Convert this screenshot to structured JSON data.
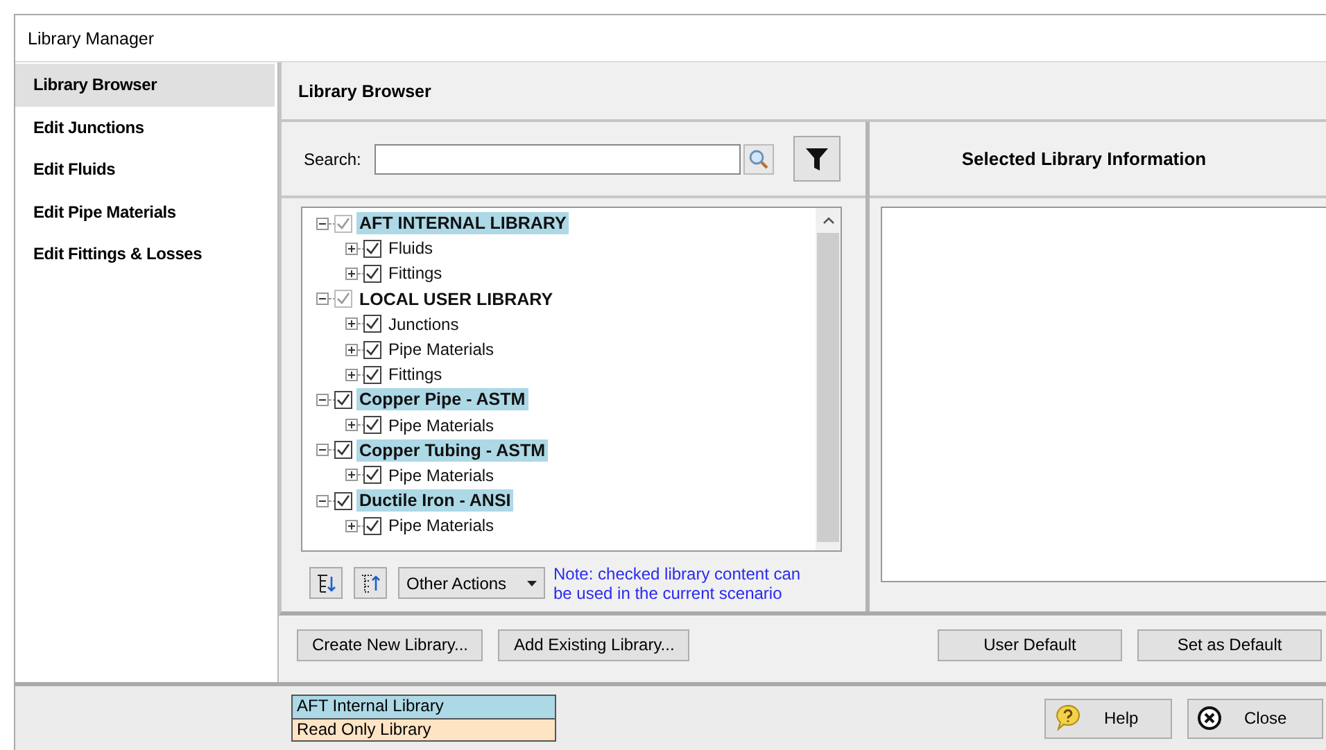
{
  "window": {
    "title": "Library Manager"
  },
  "sidebar": {
    "items": [
      {
        "label": "Library Browser",
        "selected": true
      },
      {
        "label": "Edit Junctions",
        "selected": false
      },
      {
        "label": "Edit Fluids",
        "selected": false
      },
      {
        "label": "Edit Pipe Materials",
        "selected": false
      },
      {
        "label": "Edit Fittings & Losses",
        "selected": false
      }
    ]
  },
  "panel_title": "Library Browser",
  "search": {
    "label": "Search:"
  },
  "tree": [
    {
      "label": "AFT INTERNAL LIBRARY",
      "checked": true,
      "disabled": true,
      "expanded": true,
      "highlight": true,
      "children": [
        {
          "label": "Fluids",
          "checked": true,
          "disabled": false,
          "expanded": false,
          "highlight": false
        },
        {
          "label": "Fittings",
          "checked": true,
          "disabled": false,
          "expanded": false,
          "highlight": false
        }
      ]
    },
    {
      "label": "LOCAL USER LIBRARY",
      "checked": true,
      "disabled": true,
      "expanded": true,
      "highlight": false,
      "children": [
        {
          "label": "Junctions",
          "checked": true,
          "disabled": false,
          "expanded": false,
          "highlight": false
        },
        {
          "label": "Pipe Materials",
          "checked": true,
          "disabled": false,
          "expanded": false,
          "highlight": false
        },
        {
          "label": "Fittings",
          "checked": true,
          "disabled": false,
          "expanded": false,
          "highlight": false
        }
      ]
    },
    {
      "label": "Copper Pipe - ASTM",
      "checked": true,
      "disabled": false,
      "expanded": true,
      "highlight": true,
      "children": [
        {
          "label": "Pipe Materials",
          "checked": true,
          "disabled": false,
          "expanded": false,
          "highlight": false
        }
      ]
    },
    {
      "label": "Copper Tubing - ASTM",
      "checked": true,
      "disabled": false,
      "expanded": true,
      "highlight": true,
      "children": [
        {
          "label": "Pipe Materials",
          "checked": true,
          "disabled": false,
          "expanded": false,
          "highlight": false
        }
      ]
    },
    {
      "label": "Ductile Iron - ANSI",
      "checked": true,
      "disabled": false,
      "expanded": true,
      "highlight": true,
      "children": [
        {
          "label": "Pipe Materials",
          "checked": true,
          "disabled": false,
          "expanded": false,
          "highlight": false
        }
      ]
    }
  ],
  "other_actions": "Other Actions",
  "note": "Note: checked library content can be used in the current scenario",
  "info_title": "Selected Library Information",
  "left_buttons": [
    "Create New Library...",
    "Add Existing Library..."
  ],
  "right_buttons": [
    "User Default",
    "Set as Default"
  ],
  "legend": [
    {
      "label": "AFT Internal Library",
      "color": "#add8e6"
    },
    {
      "label": "Read Only Library",
      "color": "#ffe4c4"
    }
  ],
  "footer_buttons": [
    {
      "label": "Help",
      "kind": "help"
    },
    {
      "label": "Close",
      "kind": "close"
    }
  ]
}
